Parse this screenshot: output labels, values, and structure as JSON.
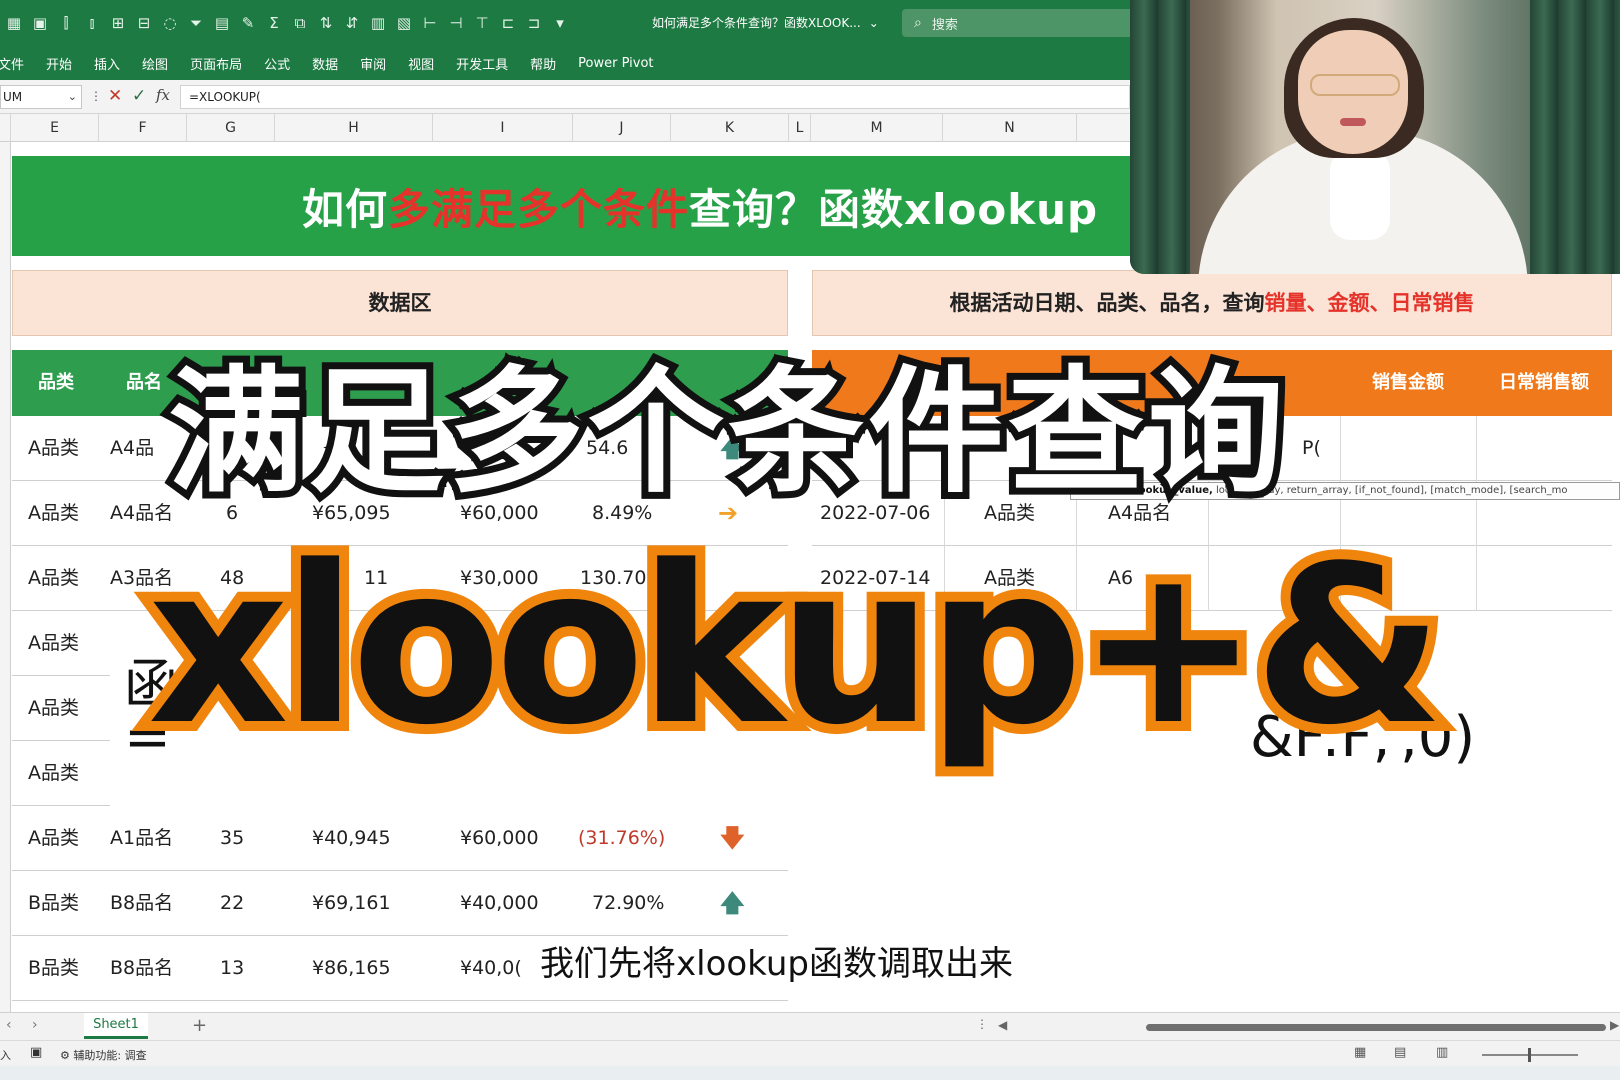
{
  "titlebar": {
    "doc_title": "如何满足多个条件查询？函数XLOOK...",
    "search_placeholder": "搜索"
  },
  "ribbon_tabs": [
    "文件",
    "开始",
    "插入",
    "绘图",
    "页面布局",
    "公式",
    "数据",
    "审阅",
    "视图",
    "开发工具",
    "帮助",
    "Power Pivot"
  ],
  "formula_bar": {
    "name_box": "UM",
    "formula": "=XLOOKUP("
  },
  "columns": [
    "E",
    "F",
    "G",
    "H",
    "I",
    "J",
    "K",
    "L",
    "M",
    "N"
  ],
  "banner": {
    "title_part1": "如何",
    "title_red": "多满足多个条件",
    "title_part2": "查询？函数xlookup"
  },
  "sections": {
    "left": "数据区",
    "right_part1": "根据活动日期、品类、品名，查询",
    "right_red": "销量、金额、日常销售"
  },
  "left_table": {
    "headers": [
      "品类",
      "品名"
    ],
    "rows": [
      [
        "A品类",
        "A4品",
        "",
        "",
        "",
        "54.6",
        "up"
      ],
      [
        "A品类",
        "A4品名",
        "6",
        "¥65,095",
        "¥60,000",
        "8.49%",
        "right"
      ],
      [
        "A品类",
        "A3品名",
        "48",
        "11",
        "¥30,000",
        "130.70%",
        ""
      ],
      [
        "A品类",
        "",
        "",
        "",
        "",
        "",
        ""
      ],
      [
        "A品类",
        "",
        "",
        "",
        "",
        "",
        ""
      ],
      [
        "A品类",
        "",
        "",
        "",
        "",
        "",
        ""
      ],
      [
        "A品类",
        "A1品名",
        "35",
        "¥40,945",
        "¥60,000",
        "(31.76%)",
        "down"
      ],
      [
        "B品类",
        "B8品名",
        "22",
        "¥69,161",
        "¥40,000",
        "72.90%",
        "up"
      ],
      [
        "B品类",
        "B8品名",
        "13",
        "¥86,165",
        "¥40,0(",
        "",
        ""
      ]
    ]
  },
  "right_table": {
    "headers": [
      "销售金额",
      "日常销售额"
    ],
    "rows": [
      [
        "",
        "",
        "",
        "P("
      ],
      [
        "2022-07-06",
        "A品类",
        "A4品名",
        ""
      ],
      [
        "2022-07-14",
        "A品类",
        "A6",
        ""
      ]
    ],
    "tooltip_bold": "XLOOKUP(lookup_value,",
    "tooltip_rest": " lookup_array, return_array, [if_not_found], [match_mode], [search_mo"
  },
  "popup": {
    "line1": "函",
    "line2_left": "=",
    "line2_mid": "&F:F,",
    "line2_right": ",0)"
  },
  "overlay": {
    "headline": "满足多个条件查询",
    "formula": "xlookup+&"
  },
  "subtitle": "我们先将xlookup函数调取出来",
  "sheet_tabs": [
    "Sheet1"
  ],
  "status": {
    "ready": "入",
    "accessibility": "辅助功能: 调查"
  },
  "colors": {
    "excel_green": "#1d7a43",
    "banner_green": "#27a148",
    "header_orange": "#f07a1b",
    "accent_red": "#e5322a",
    "overlay_orange": "#f0850e"
  }
}
